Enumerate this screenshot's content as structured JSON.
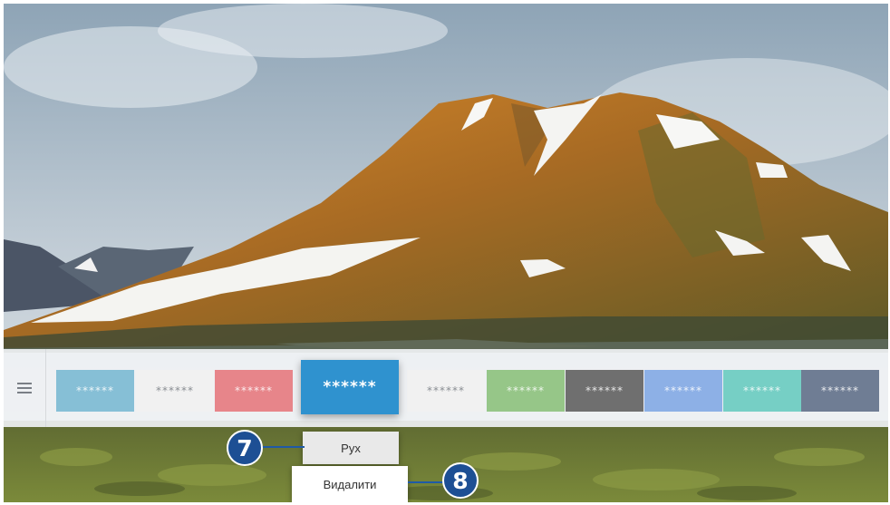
{
  "smart_hub": {
    "menu_icon": "hamburger-menu-icon",
    "tiles": [
      {
        "label": "******",
        "color": "#86bfd6"
      },
      {
        "label": "******",
        "color": "#f1f1f1"
      },
      {
        "label": "******",
        "color": "#e7858a"
      },
      {
        "label": "******",
        "color": "#2f92cf",
        "focused": true
      },
      {
        "label": "******",
        "color": "#f1f1f1"
      },
      {
        "label": "******",
        "color": "#96c688"
      },
      {
        "label": "******",
        "color": "#6f6f6f"
      },
      {
        "label": "******",
        "color": "#8db0e6"
      },
      {
        "label": "******",
        "color": "#76cfc5"
      },
      {
        "label": "******",
        "color": "#6f7d94"
      }
    ]
  },
  "context_menu": {
    "move_label": "Рух",
    "delete_label": "Видалити"
  },
  "callouts": {
    "move_number": "7",
    "delete_number": "8",
    "color": "#1d4f94"
  }
}
